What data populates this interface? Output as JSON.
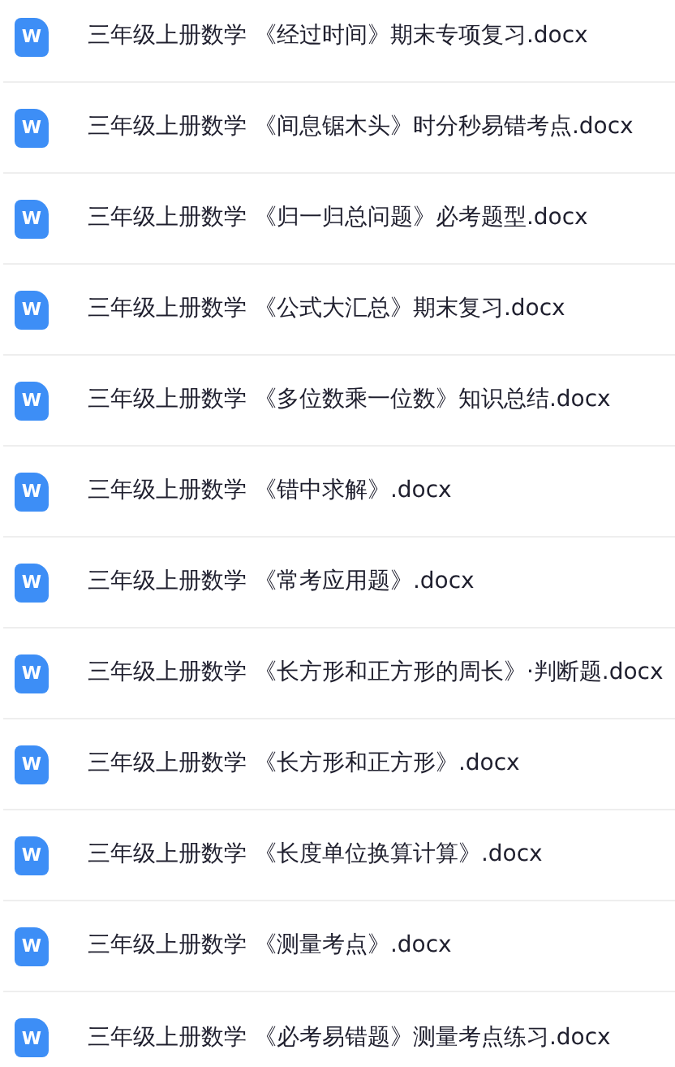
{
  "files": [
    {
      "icon": "W",
      "name": "三年级上册数学 《经过时间》期末专项复习.docx"
    },
    {
      "icon": "W",
      "name": "三年级上册数学 《间息锯木头》时分秒易错考点.docx"
    },
    {
      "icon": "W",
      "name": "三年级上册数学 《归一归总问题》必考题型.docx"
    },
    {
      "icon": "W",
      "name": "三年级上册数学 《公式大汇总》期末复习.docx"
    },
    {
      "icon": "W",
      "name": "三年级上册数学 《多位数乘一位数》知识总结.docx"
    },
    {
      "icon": "W",
      "name": "三年级上册数学 《错中求解》.docx"
    },
    {
      "icon": "W",
      "name": "三年级上册数学 《常考应用题》.docx"
    },
    {
      "icon": "W",
      "name": "三年级上册数学 《长方形和正方形的周长》·判断题.docx"
    },
    {
      "icon": "W",
      "name": "三年级上册数学 《长方形和正方形》.docx"
    },
    {
      "icon": "W",
      "name": "三年级上册数学 《长度单位换算计算》.docx"
    },
    {
      "icon": "W",
      "name": "三年级上册数学 《测量考点》.docx"
    },
    {
      "icon": "W",
      "name": "三年级上册数学 《必考易错题》测量考点练习.docx"
    }
  ]
}
